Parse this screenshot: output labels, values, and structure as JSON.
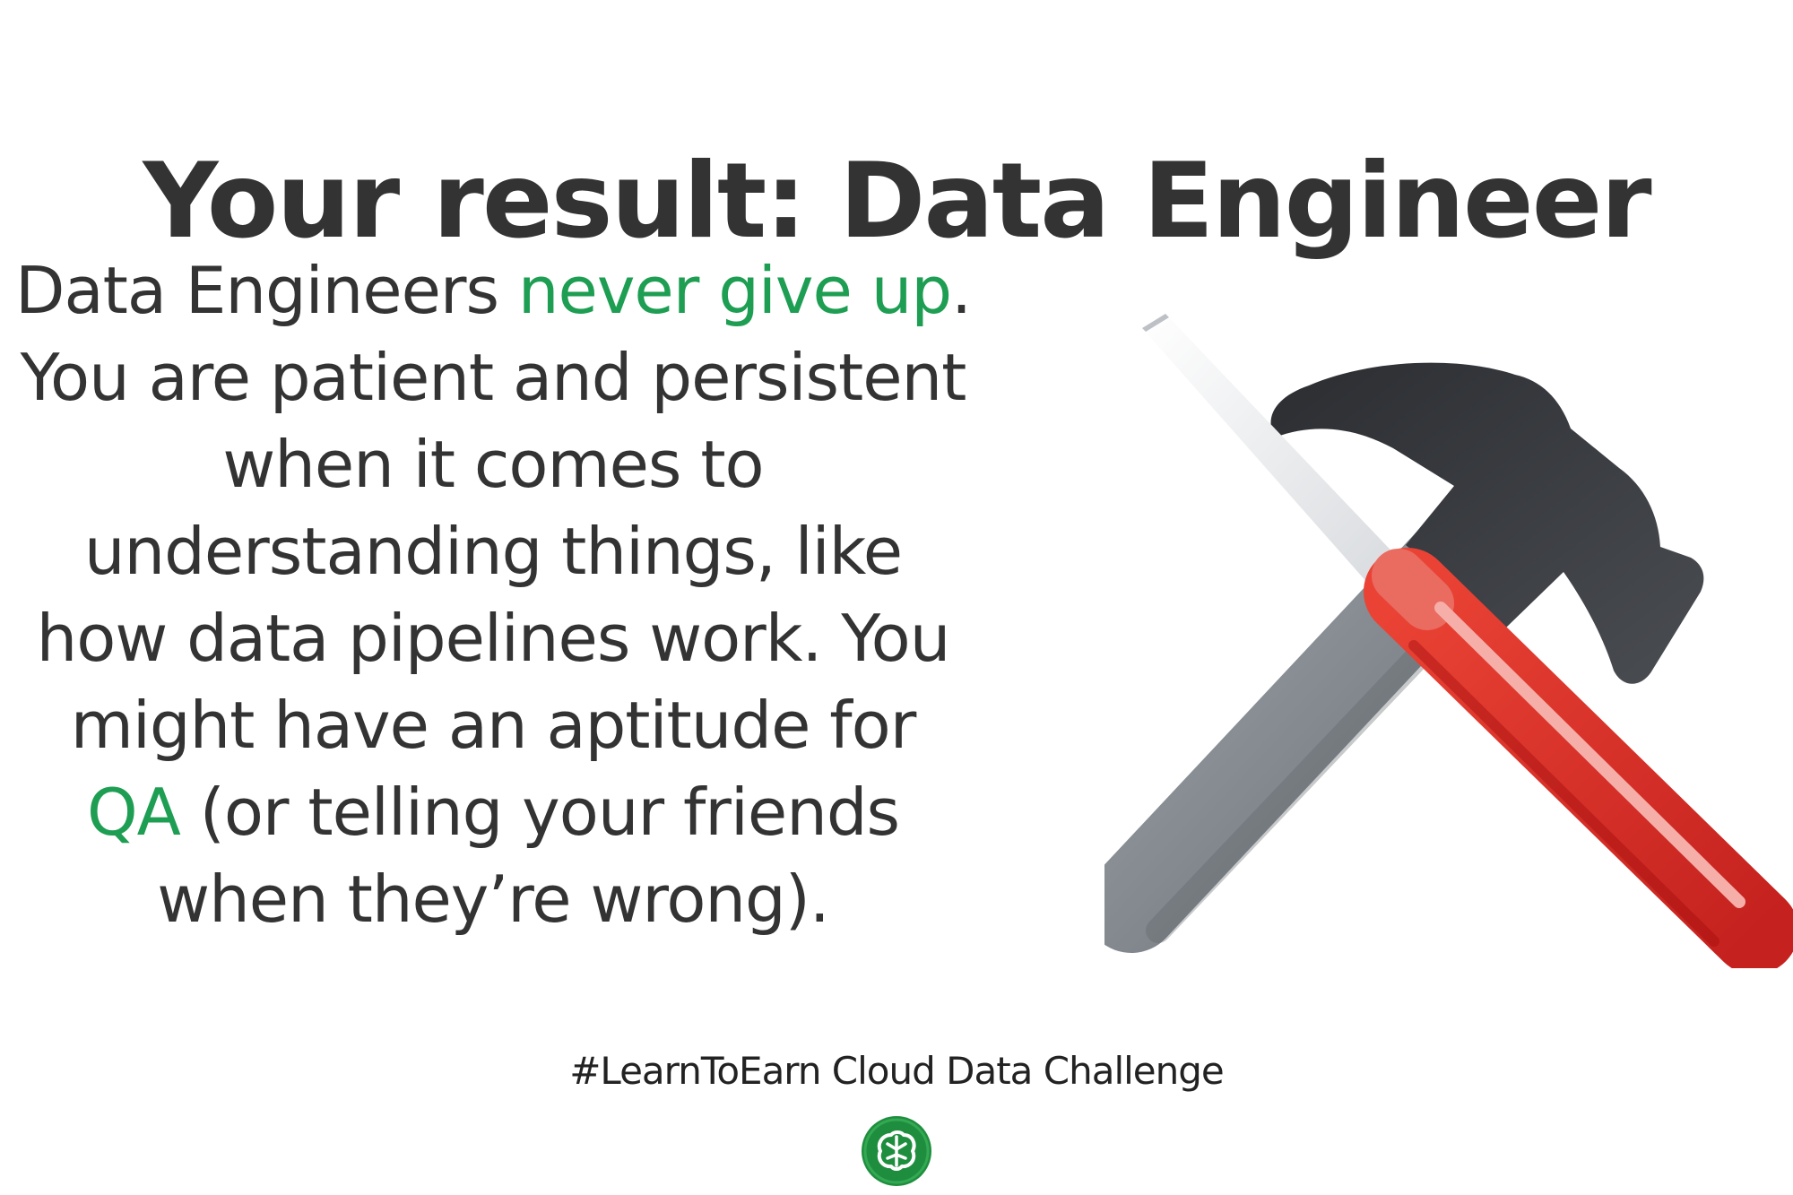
{
  "title": {
    "prefix": "Your result: ",
    "role": "Data Engineer"
  },
  "description": {
    "lines": [
      {
        "before": "Data Engineers ",
        "accent": "never give up",
        "after": "."
      },
      {
        "text": "You are patient and persistent"
      },
      {
        "text": "when it comes to"
      },
      {
        "text": "understanding things, like"
      },
      {
        "text": "how data pipelines work. You"
      },
      {
        "text": "might have an aptitude for"
      },
      {
        "accent": "QA",
        "after": " (or telling your friends"
      },
      {
        "text": "when they’re wrong)."
      }
    ]
  },
  "footer": {
    "hashtag": "#LearnToEarn Cloud Data Challenge"
  },
  "icons": {
    "illustration": "hammer-and-screwdriver-icon",
    "logo": "brain-logo-icon"
  },
  "colors": {
    "accent": "#1e9e52",
    "text": "#333333",
    "hammer_head": "#3a3c40",
    "hammer_handle": "#80868b",
    "screwdriver_handle": "#d93025",
    "screwdriver_shaft": "#e8eaed"
  }
}
